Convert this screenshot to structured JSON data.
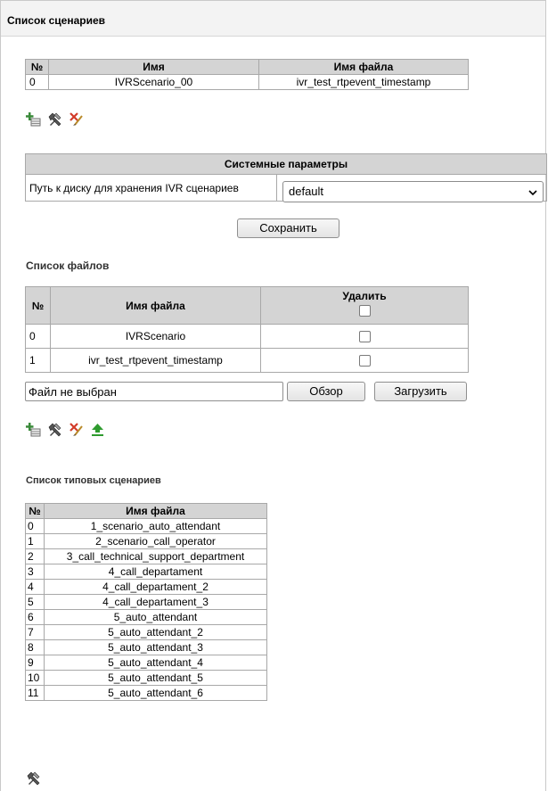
{
  "header": {
    "title": "Список сценариев"
  },
  "scenarios_table": {
    "columns": [
      "№",
      "Имя",
      "Имя файла"
    ],
    "rows": [
      [
        "0",
        "IVRScenario_00",
        "ivr_test_rtpevent_timestamp"
      ]
    ]
  },
  "toolbar_icons": [
    "add-icon",
    "edit-icon",
    "delete-icon"
  ],
  "system_params": {
    "title": "Системные параметры",
    "disk_path_label": "Путь к диску для хранения IVR сценариев",
    "disk_path_value": "default",
    "save_label": "Сохранить"
  },
  "files": {
    "title": "Список файлов",
    "columns": [
      "№",
      "Имя файла",
      "Удалить"
    ],
    "rows": [
      [
        "0",
        "IVRScenario"
      ],
      [
        "1",
        "ivr_test_rtpevent_timestamp"
      ]
    ],
    "no_file_text": "Файл не выбран",
    "browse_label": "Обзор",
    "upload_label": "Загрузить",
    "toolbar_icons": [
      "add-icon",
      "edit-icon",
      "delete-icon",
      "upload-icon"
    ]
  },
  "typical": {
    "title": "Список типовых сценариев",
    "columns": [
      "№",
      "Имя файла"
    ],
    "rows": [
      [
        "0",
        "1_scenario_auto_attendant"
      ],
      [
        "1",
        "2_scenario_call_operator"
      ],
      [
        "2",
        "3_call_technical_support_department"
      ],
      [
        "3",
        "4_call_departament"
      ],
      [
        "4",
        "4_call_departament_2"
      ],
      [
        "5",
        "4_call_departament_3"
      ],
      [
        "6",
        "5_auto_attendant"
      ],
      [
        "7",
        "5_auto_attendant_2"
      ],
      [
        "8",
        "5_auto_attendant_3"
      ],
      [
        "9",
        "5_auto_attendant_4"
      ],
      [
        "10",
        "5_auto_attendant_5"
      ],
      [
        "11",
        "5_auto_attendant_6"
      ]
    ],
    "toolbar_icons": [
      "edit-icon"
    ]
  },
  "colors": {
    "header_bg": "#d4d4d4",
    "add_icon": "#3a8a3a",
    "delete_icon": "#d23b2a",
    "upload_icon": "#2e9b2e"
  }
}
